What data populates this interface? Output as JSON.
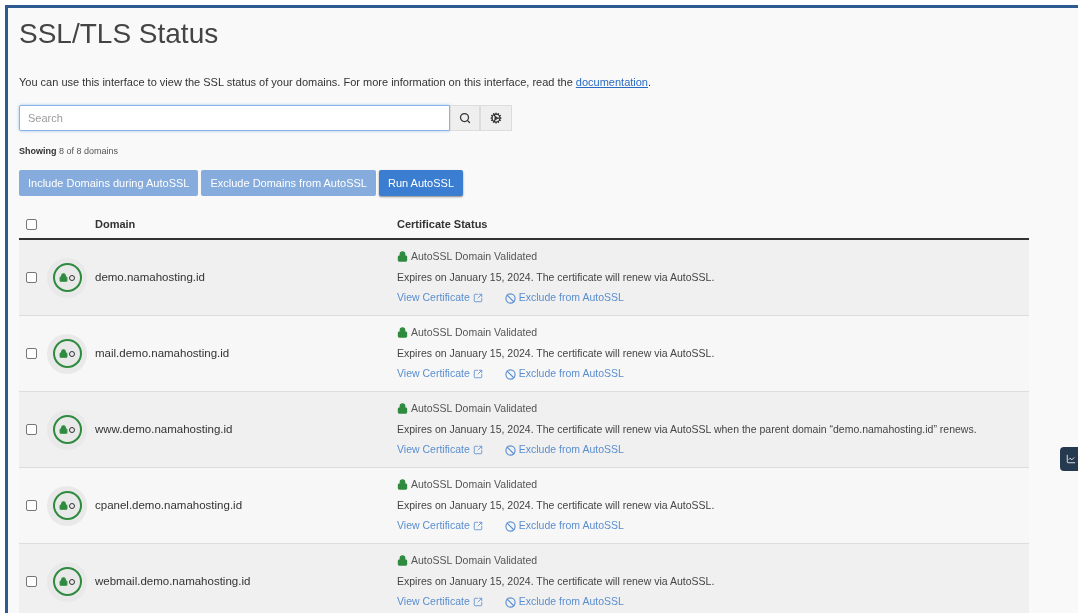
{
  "title": "SSL/TLS Status",
  "intro": {
    "text": "You can use this interface to view the SSL status of your domains. For more information on this interface, read the",
    "link": "documentation",
    "end": "."
  },
  "search": {
    "placeholder": "Search"
  },
  "showing": {
    "bold": "Showing",
    "rest": "8 of 8 domains"
  },
  "actions": [
    {
      "label": "Include Domains during AutoSSL",
      "disabled": true
    },
    {
      "label": "Exclude Domains from AutoSSL",
      "disabled": true
    },
    {
      "label": "Run AutoSSL",
      "disabled": false
    }
  ],
  "table": {
    "select_all": {
      "checked": false
    },
    "columns": [
      "Domain",
      "Certificate Status"
    ],
    "rows": [
      {
        "checked": false,
        "domain": "demo.namahosting.id",
        "status": "AutoSSL Domain Validated",
        "detail": "Expires on January 15, 2024. The certificate will renew via AutoSSL.",
        "view": "View Certificate",
        "exclude": "Exclude from AutoSSL"
      },
      {
        "checked": false,
        "domain": "mail.demo.namahosting.id",
        "status": "AutoSSL Domain Validated",
        "detail": "Expires on January 15, 2024. The certificate will renew via AutoSSL.",
        "view": "View Certificate",
        "exclude": "Exclude from AutoSSL"
      },
      {
        "checked": false,
        "domain": "www.demo.namahosting.id",
        "status": "AutoSSL Domain Validated",
        "detail": "Expires on January 15, 2024. The certificate will renew via AutoSSL when the parent domain “demo.namahosting.id” renews.",
        "view": "View Certificate",
        "exclude": "Exclude from AutoSSL"
      },
      {
        "checked": false,
        "domain": "cpanel.demo.namahosting.id",
        "status": "AutoSSL Domain Validated",
        "detail": "Expires on January 15, 2024. The certificate will renew via AutoSSL.",
        "view": "View Certificate",
        "exclude": "Exclude from AutoSSL"
      },
      {
        "checked": false,
        "domain": "webmail.demo.namahosting.id",
        "status": "AutoSSL Domain Validated",
        "detail": "Expires on January 15, 2024. The certificate will renew via AutoSSL.",
        "view": "View Certificate",
        "exclude": "Exclude from AutoSSL"
      }
    ]
  }
}
